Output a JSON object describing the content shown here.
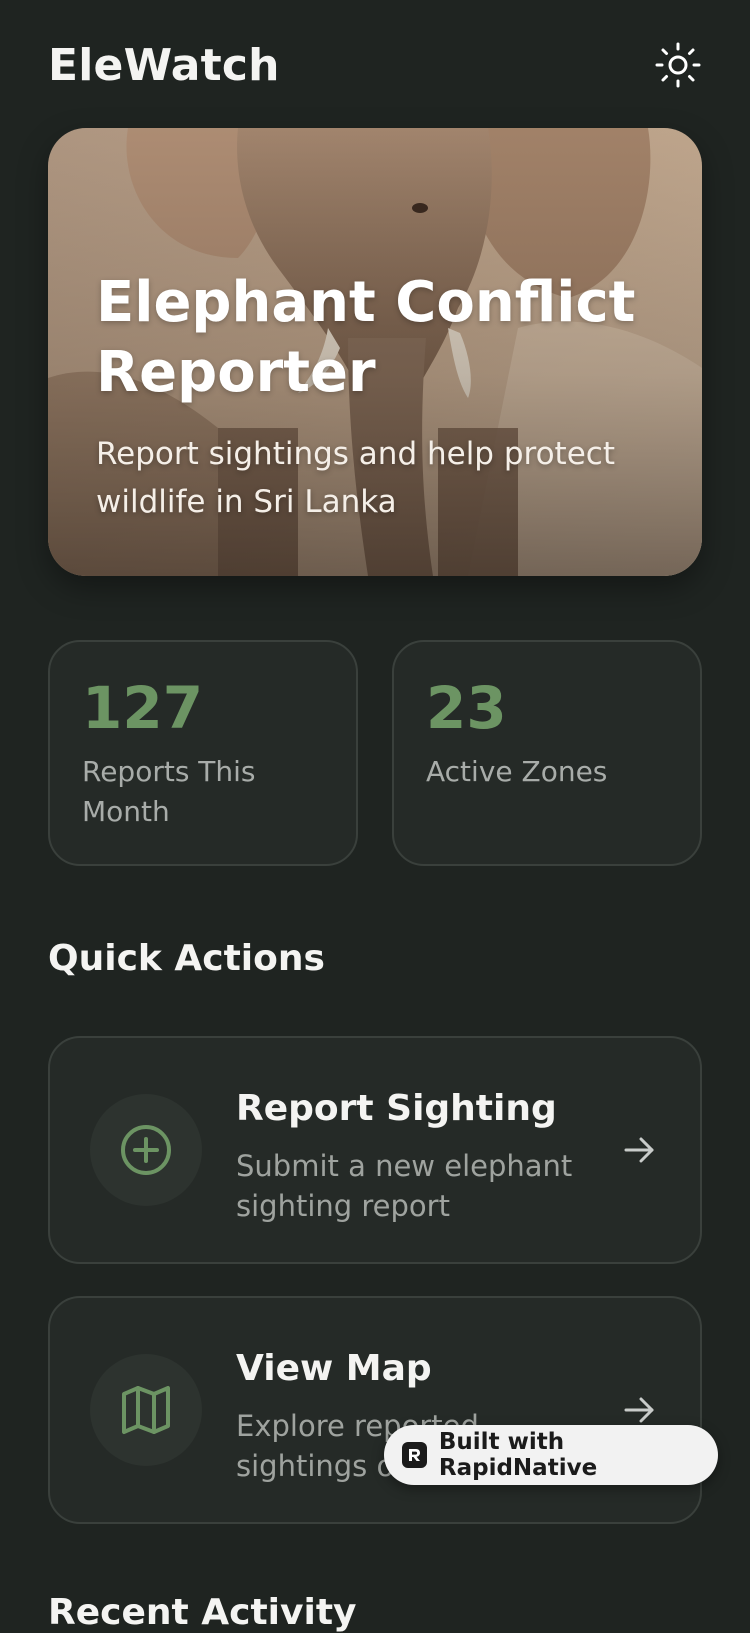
{
  "app": {
    "title": "EleWatch",
    "theme_toggle_icon": "sun-icon"
  },
  "hero": {
    "title": "Elephant Conflict Reporter",
    "subtitle": "Report sightings and help protect wildlife in Sri Lanka",
    "image": "elephant-photo"
  },
  "stats": [
    {
      "value": "127",
      "label": "Reports This Month"
    },
    {
      "value": "23",
      "label": "Active Zones"
    }
  ],
  "quick_actions": {
    "heading": "Quick Actions",
    "items": [
      {
        "title": "Report Sighting",
        "description": "Submit a new elephant sighting report",
        "icon": "plus-circle-icon"
      },
      {
        "title": "View Map",
        "description": "Explore reported sightings on map",
        "icon": "map-icon"
      }
    ]
  },
  "recent_activity": {
    "heading": "Recent Activity"
  },
  "badge": {
    "label": "Built with RapidNative"
  },
  "colors": {
    "background": "#1f2421",
    "card": "#252a27",
    "accent": "#6c9463",
    "muted_text": "#a8aca9"
  }
}
